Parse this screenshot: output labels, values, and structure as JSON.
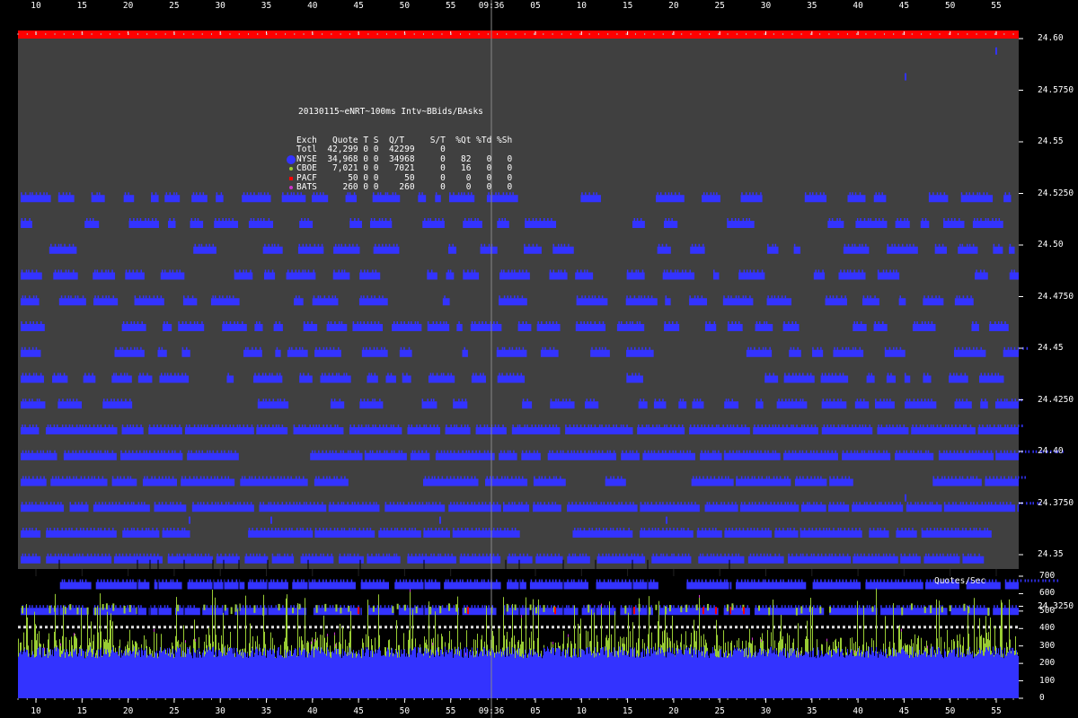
{
  "chart_data": [
    {
      "type": "scatter",
      "title": "20130115~eNRT~100ms Intv~BBids/BAsks",
      "ylim": [
        24.315,
        24.61
      ],
      "y_ticks": [
        "24.60",
        "24.5750",
        "24.55",
        "24.5250",
        "24.50",
        "24.4750",
        "24.45",
        "24.4250",
        "24.40",
        "24.3750",
        "24.35",
        "24.3250"
      ],
      "x_ticks_before": [
        "10",
        "15",
        "20",
        "25",
        "30",
        "35",
        "40",
        "45",
        "50",
        "55"
      ],
      "x_tick_center": "09:36",
      "x_ticks_after": [
        "05",
        "10",
        "15",
        "20",
        "25",
        "30",
        "35",
        "40",
        "45",
        "50",
        "55"
      ],
      "legend_header": [
        "Exch",
        "Quote",
        "T",
        "S",
        "Q/T",
        "S/T",
        "%Qt",
        "%Td",
        "%Sh"
      ],
      "legend_rows": [
        {
          "exch": "Totl",
          "quote": "42,299",
          "t": "0",
          "s": "0",
          "qt": "42299",
          "st": "0",
          "pq": "",
          "pt": "",
          "ps": "",
          "color": ""
        },
        {
          "exch": "NYSE",
          "quote": "34,968",
          "t": "0",
          "s": "0",
          "qt": "34968",
          "st": "0",
          "pq": "82",
          "pt": "0",
          "ps": "0",
          "color": "#3333ff"
        },
        {
          "exch": "CBOE",
          "quote": "7,021",
          "t": "0",
          "s": "0",
          "qt": "7021",
          "st": "0",
          "pq": "16",
          "pt": "0",
          "ps": "0",
          "color": "#99cc33"
        },
        {
          "exch": "PACF",
          "quote": "50",
          "t": "0",
          "s": "0",
          "qt": "50",
          "st": "0",
          "pq": "0",
          "pt": "0",
          "ps": "0",
          "color": "#ff0000"
        },
        {
          "exch": "BATS",
          "quote": "260",
          "t": "0",
          "s": "0",
          "qt": "260",
          "st": "0",
          "pq": "0",
          "pt": "0",
          "ps": "0",
          "color": "#cc33cc"
        }
      ],
      "price_levels": [
        24.5225,
        24.51,
        24.4975,
        24.485,
        24.4725,
        24.46,
        24.4475,
        24.435,
        24.4225,
        24.41,
        24.3975,
        24.385,
        24.3725,
        24.36,
        24.3475,
        24.335,
        24.3225
      ]
    },
    {
      "type": "area",
      "title": "Quotes/Sec",
      "ylim": [
        0,
        700
      ],
      "y_ticks": [
        "700",
        "600",
        "500",
        "400",
        "300",
        "200",
        "100",
        "0"
      ],
      "series": [
        {
          "name": "NYSE",
          "color": "#3333ff",
          "baseline": 270
        },
        {
          "name": "CBOE",
          "color": "#99cc33",
          "peak": 620
        }
      ]
    }
  ],
  "colors": {
    "background": "#000000",
    "plot_bg": "#404040",
    "ceiling": "#ff0000",
    "nyse": "#3333ff",
    "cboe": "#99cc33",
    "pacf": "#ff0000",
    "bats": "#cc33cc"
  }
}
